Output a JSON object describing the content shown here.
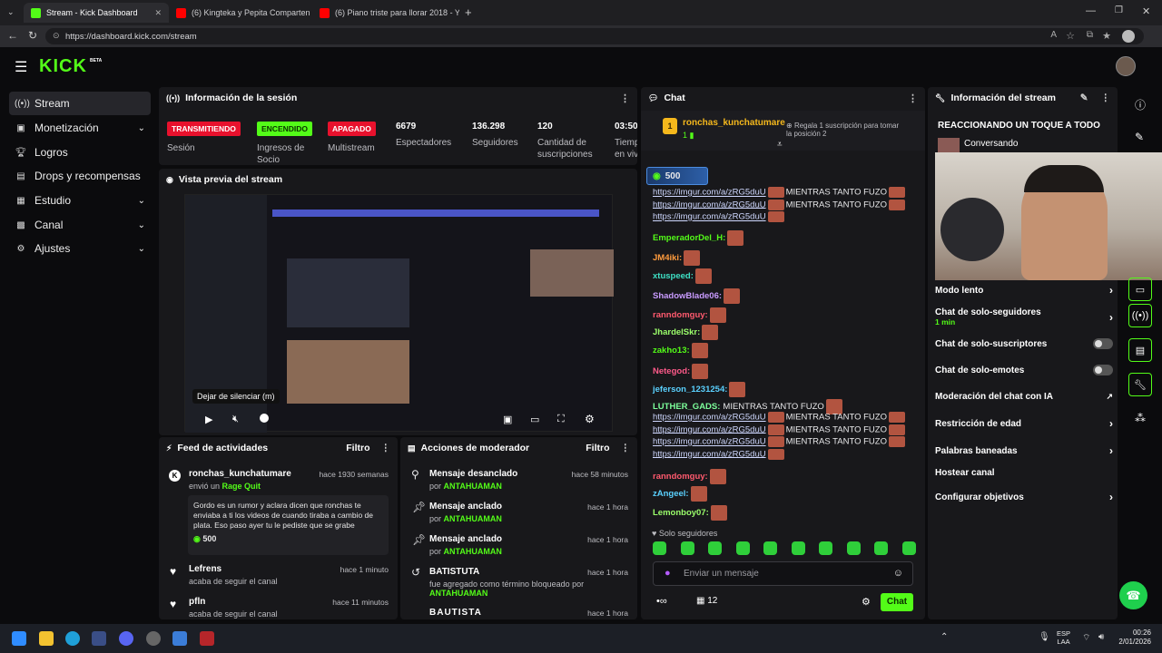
{
  "browser": {
    "tabs": [
      {
        "label": "Stream - Kick Dashboard",
        "color": "#53fc18"
      },
      {
        "label": "(6) Kingteka y Pepita Comparten C",
        "color": "#ff0000"
      },
      {
        "label": "(6) Piano triste para llorar 2018 - Y",
        "color": "#ff0000"
      }
    ],
    "url": "https://dashboard.kick.com/stream"
  },
  "logo": {
    "text": "KICK",
    "beta": "BETA"
  },
  "sidebar": {
    "items": [
      {
        "label": "Stream",
        "icon": "stream-icon",
        "chevron": false
      },
      {
        "label": "Monetización",
        "icon": "money-icon",
        "chevron": true
      },
      {
        "label": "Logros",
        "icon": "trophy-icon",
        "chevron": false
      },
      {
        "label": "Drops y recompensas",
        "icon": "gift-icon",
        "chevron": false
      },
      {
        "label": "Estudio",
        "icon": "studio-icon",
        "chevron": true
      },
      {
        "label": "Canal",
        "icon": "channel-icon",
        "chevron": true
      },
      {
        "label": "Ajustes",
        "icon": "gear-icon",
        "chevron": true
      }
    ]
  },
  "session": {
    "title": "Información de la sesión",
    "stats": [
      {
        "badge": "TRANSMITIENDO",
        "badge_color": "#e8112d",
        "label": "Sesión"
      },
      {
        "badge": "ENCENDIDO",
        "badge_color": "#53fc18",
        "label": "Ingresos de Socio"
      },
      {
        "badge": "APAGADO",
        "badge_color": "#e8112d",
        "label": "Multistream"
      },
      {
        "value": "6679",
        "label": "Espectadores"
      },
      {
        "value": "136.298",
        "label": "Seguidores"
      },
      {
        "value": "120",
        "label": "Cantidad de suscripciones"
      },
      {
        "value": "03:50",
        "label": "Tiempo en vivo"
      }
    ]
  },
  "preview": {
    "title": "Vista previa del stream",
    "tooltip": "Dejar de silenciar (m)"
  },
  "feed": {
    "title": "Feed de actividades",
    "filter": "Filtro",
    "items": [
      {
        "name": "ronchas_kunchatumare",
        "time": "hace 1930 semanas",
        "action": "envió un",
        "highlight": "Rage Quit",
        "message": "Gordo es un rumor y aclara dicen que ronchas te enviaba a ti los videos de cuando tiraba a cambio de plata. Eso paso ayer tu le pediste que se grabe",
        "amount": "500"
      },
      {
        "name": "Lefrens",
        "time": "hace 1 minuto",
        "action": "acaba de seguir el canal"
      },
      {
        "name": "pfln",
        "time": "hace 11 minutos",
        "action": "acaba de seguir el canal"
      }
    ]
  },
  "mod": {
    "title": "Acciones de moderador",
    "filter": "Filtro",
    "items": [
      {
        "title": "Mensaje desanclado",
        "sub": "por",
        "who": "ANTAHUAMAN",
        "time": "hace 58 minutos",
        "icon": "unpin-icon"
      },
      {
        "title": "Mensaje anclado",
        "sub": "por",
        "who": "ANTAHUAMAN",
        "time": "hace 1 hora",
        "icon": "pin-icon"
      },
      {
        "title": "Mensaje anclado",
        "sub": "por",
        "who": "ANTAHUAMAN",
        "time": "hace 1 hora",
        "icon": "pin-icon"
      },
      {
        "title": "BATISTUTA",
        "sub": "fue agregado como término bloqueado por",
        "who": "ANTAHUAMAN",
        "time": "hace 1 hora",
        "icon": "history-icon"
      },
      {
        "title": "BAUTISTA",
        "sub": "",
        "who": "",
        "time": "hace 1 hora",
        "icon": "history-icon"
      }
    ]
  },
  "chat": {
    "title": "Chat",
    "pinned": {
      "rank": "1",
      "name": "ronchas_kunchatumare",
      "count": "1",
      "gift_text": "Regala 1 suscripción para tomar la posición 2"
    },
    "kicks": "500",
    "lines": [
      {
        "name": "",
        "name_color": "#fff",
        "links": 3,
        "text": "MIENTRAS TANTO FUZO"
      },
      {
        "name": "EmperadorDel_H:",
        "name_color": "#53fc18"
      },
      {
        "name": "JM4iki:",
        "name_color": "#ff9b3d"
      },
      {
        "name": "xtuspeed:",
        "name_color": "#3ee0c5"
      },
      {
        "name": "ShadowBlade06:",
        "name_color": "#c99bff"
      },
      {
        "name": "ranndomguy:",
        "name_color": "#ff5a6e"
      },
      {
        "name": "JhardelSkr:",
        "name_color": "#9bff6b"
      },
      {
        "name": "zakho13:",
        "name_color": "#53fc18"
      },
      {
        "name": "Netegod:",
        "name_color": "#ff5a8a"
      },
      {
        "name": "jeferson_1231254:",
        "name_color": "#5ad1ff"
      },
      {
        "name": "LUTHER_GADS:",
        "name_color": "#7dff9b",
        "text": "MIENTRAS TANTO FUZO",
        "links": 4
      },
      {
        "name": "ranndomguy:",
        "name_color": "#ff5a6e"
      },
      {
        "name": "zAngeel:",
        "name_color": "#5ad1ff"
      },
      {
        "name": "Lemonboy07:",
        "name_color": "#9bff6b"
      }
    ],
    "link_text": "https://imgur.com/a/zRG5duU",
    "followers_only": "Solo seguidores",
    "input_placeholder": "Enviar un mensaje",
    "viewers": "12",
    "send": "Chat"
  },
  "info": {
    "title": "Información del stream",
    "stream_title": "REACCIONANDO UN TOQUE A TODO",
    "category": "Conversando",
    "settings": [
      {
        "label": "Modo lento",
        "type": "chevron"
      },
      {
        "label": "Chat de solo-seguidores",
        "sub": "1 min",
        "type": "chevron"
      },
      {
        "label": "Chat de solo-suscriptores",
        "type": "toggle"
      },
      {
        "label": "Chat de solo-emotes",
        "type": "toggle"
      },
      {
        "label": "Moderación del chat con IA",
        "type": "external"
      },
      {
        "label": "Restricción de edad",
        "type": "chevron"
      },
      {
        "label": "Palabras baneadas",
        "type": "chevron"
      },
      {
        "label": "Hostear canal",
        "type": "none"
      },
      {
        "label": "Configurar objetivos",
        "type": "chevron"
      }
    ]
  },
  "taskbar": {
    "lang": "ESP",
    "region": "LAA",
    "time": "00:26",
    "date": "2/01/2026"
  }
}
